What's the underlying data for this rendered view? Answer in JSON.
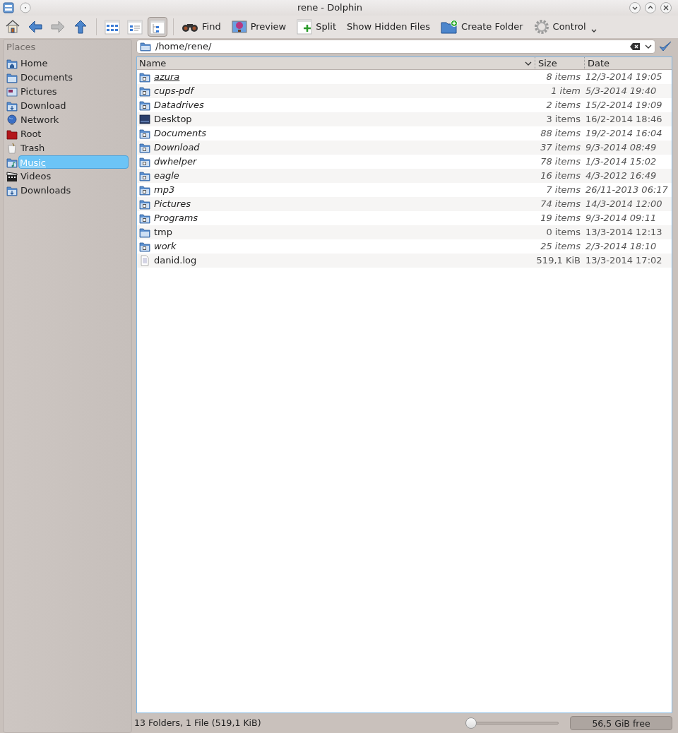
{
  "window": {
    "title": "rene - Dolphin"
  },
  "toolbar": {
    "nav": [
      {
        "kind": "home",
        "disabled": false
      },
      {
        "kind": "back",
        "disabled": false
      },
      {
        "kind": "forward",
        "disabled": true
      },
      {
        "kind": "up",
        "disabled": false
      }
    ],
    "view_modes": [
      {
        "kind": "icons",
        "selected": false
      },
      {
        "kind": "compact",
        "selected": false
      },
      {
        "kind": "details",
        "selected": true
      }
    ],
    "actions": [
      {
        "kind": "find",
        "label": "Find"
      },
      {
        "kind": "preview",
        "label": "Preview"
      },
      {
        "kind": "split",
        "label": "Split"
      },
      {
        "kind": "none",
        "label": "Show Hidden Files"
      },
      {
        "kind": "create-folder",
        "label": "Create Folder"
      },
      {
        "kind": "control",
        "label": "Control"
      }
    ]
  },
  "places": {
    "title": "Places",
    "items": [
      {
        "label": "Home",
        "kind": "home",
        "selected": false
      },
      {
        "label": "Documents",
        "kind": "folder",
        "selected": false
      },
      {
        "label": "Pictures",
        "kind": "pictures",
        "selected": false
      },
      {
        "label": "Download",
        "kind": "download",
        "selected": false
      },
      {
        "label": "Network",
        "kind": "network",
        "selected": false
      },
      {
        "label": "Root",
        "kind": "root",
        "selected": false
      },
      {
        "label": "Trash",
        "kind": "trash",
        "selected": false
      },
      {
        "label": "Music",
        "kind": "music",
        "selected": true
      },
      {
        "label": "Videos",
        "kind": "videos",
        "selected": false
      },
      {
        "label": "Downloads",
        "kind": "download",
        "selected": false
      }
    ]
  },
  "location": {
    "value": "/home/rene/"
  },
  "table": {
    "columns": [
      "Name",
      "Size",
      "Date"
    ],
    "rows": [
      {
        "name": "azura",
        "size": "8 items",
        "date": "12/3-2014 19:05",
        "kind": "link-folder",
        "hovered": true
      },
      {
        "name": "cups-pdf",
        "size": "1 item",
        "date": "5/3-2014 19:40",
        "kind": "link-folder",
        "hovered": false
      },
      {
        "name": "Datadrives",
        "size": "2 items",
        "date": "15/2-2014 19:09",
        "kind": "link-folder",
        "hovered": false
      },
      {
        "name": "Desktop",
        "size": "3 items",
        "date": "16/2-2014 18:46",
        "kind": "desktop",
        "hovered": false
      },
      {
        "name": "Documents",
        "size": "88 items",
        "date": "19/2-2014 16:04",
        "kind": "link-folder",
        "hovered": false
      },
      {
        "name": "Download",
        "size": "37 items",
        "date": "9/3-2014 08:49",
        "kind": "link-folder",
        "hovered": false
      },
      {
        "name": "dwhelper",
        "size": "78 items",
        "date": "1/3-2014 15:02",
        "kind": "link-folder",
        "hovered": false
      },
      {
        "name": "eagle",
        "size": "16 items",
        "date": "4/3-2012 16:49",
        "kind": "link-folder",
        "hovered": false
      },
      {
        "name": "mp3",
        "size": "7 items",
        "date": "26/11-2013 06:17",
        "kind": "link-folder",
        "hovered": false
      },
      {
        "name": "Pictures",
        "size": "74 items",
        "date": "14/3-2014 12:00",
        "kind": "link-folder",
        "hovered": false
      },
      {
        "name": "Programs",
        "size": "19 items",
        "date": "9/3-2014 09:11",
        "kind": "link-folder",
        "hovered": false
      },
      {
        "name": "tmp",
        "size": "0 items",
        "date": "13/3-2014 12:13",
        "kind": "folder",
        "hovered": false
      },
      {
        "name": "work",
        "size": "25 items",
        "date": "2/3-2014 18:10",
        "kind": "link-folder",
        "hovered": false
      },
      {
        "name": "danid.log",
        "size": "519,1 KiB",
        "date": "13/3-2014 17:02",
        "kind": "file",
        "hovered": false
      }
    ]
  },
  "status_bar": {
    "text": "13 Folders, 1 File (519,1 KiB)",
    "zoom": {
      "level": 0.03
    },
    "free_space": "56,5 GiB free"
  }
}
